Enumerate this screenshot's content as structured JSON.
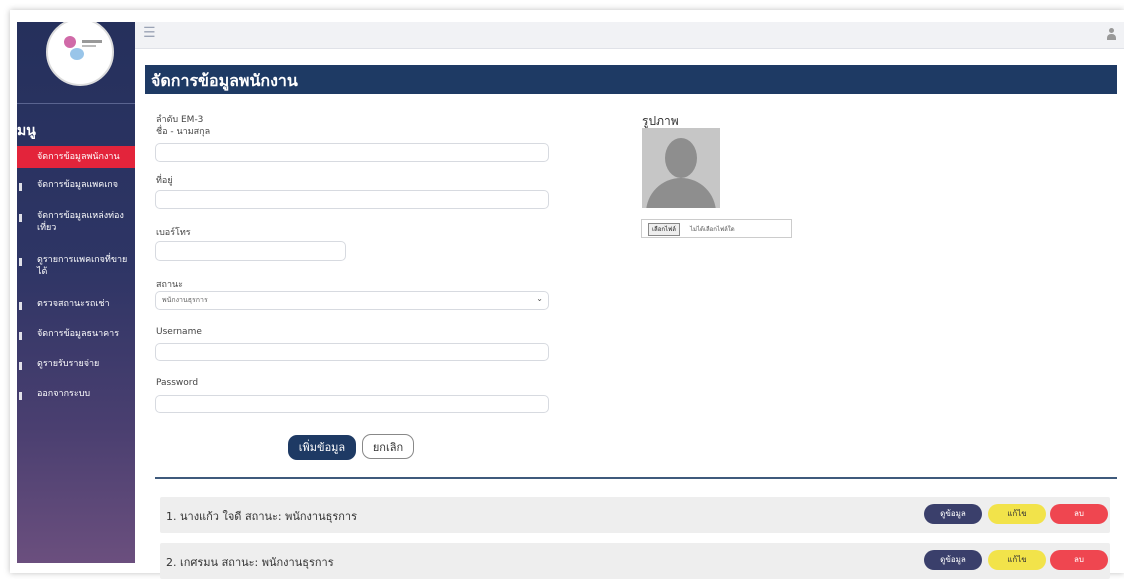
{
  "sidebar": {
    "menu_title": "มนู",
    "items": [
      {
        "label": "จัดการข้อมูลพนักงาน",
        "active": true
      },
      {
        "label": "จัดการข้อมูลแพคเกจ"
      },
      {
        "label": "จัดการข้อมูลแหล่งท่องเที่ยว"
      },
      {
        "label": "ดูรายการแพคเกจที่ขายได้"
      },
      {
        "label": "ตรวจสถานะรถเช่า"
      },
      {
        "label": "จัดการข้อมูลธนาคาร"
      },
      {
        "label": "ดูรายรับรายจ่าย"
      },
      {
        "label": "ออกจากระบบ"
      }
    ]
  },
  "topbar": {
    "menu_icon": "hamburger-icon",
    "user_icon": "user-icon"
  },
  "page": {
    "title": "จัดการข้อมูลพนักงาน"
  },
  "form": {
    "sequence_label": "ลำดับ EM-3",
    "name_label": "ชื่อ - นามสกุล",
    "name_value": "",
    "address_label": "ที่อยู่",
    "address_value": "",
    "phone_label": "เบอร์โทร",
    "phone_value": "",
    "status_label": "สถานะ",
    "status_selected": "พนักงานธุรการ",
    "username_label": "Username",
    "username_value": "",
    "password_label": "Password",
    "password_value": ""
  },
  "photo": {
    "title": "รูปภาพ",
    "choose_file_label": "เลือกไฟล์",
    "file_status": "ไม่ได้เลือกไฟล์ใด"
  },
  "buttons": {
    "add": "เพิ่มข้อมูล",
    "cancel": "ยกเลิก"
  },
  "employees": [
    {
      "text": "1. นางแก้ว ใจดี สถานะ: พนักงานธุรการ",
      "view": "ดูข้อมูล",
      "edit": "แก้ไข",
      "delete": "ลบ"
    },
    {
      "text": "2. เกศรมน สถานะ: พนักงานธุรการ",
      "view": "ดูข้อมูล",
      "edit": "แก้ไข",
      "delete": "ลบ"
    }
  ],
  "colors": {
    "sidebar_top": "#25305c",
    "sidebar_bottom": "#6b4f7e",
    "active": "#e3243b",
    "header": "#1e3a64",
    "edit": "#f2e34a",
    "delete": "#ef4650"
  }
}
